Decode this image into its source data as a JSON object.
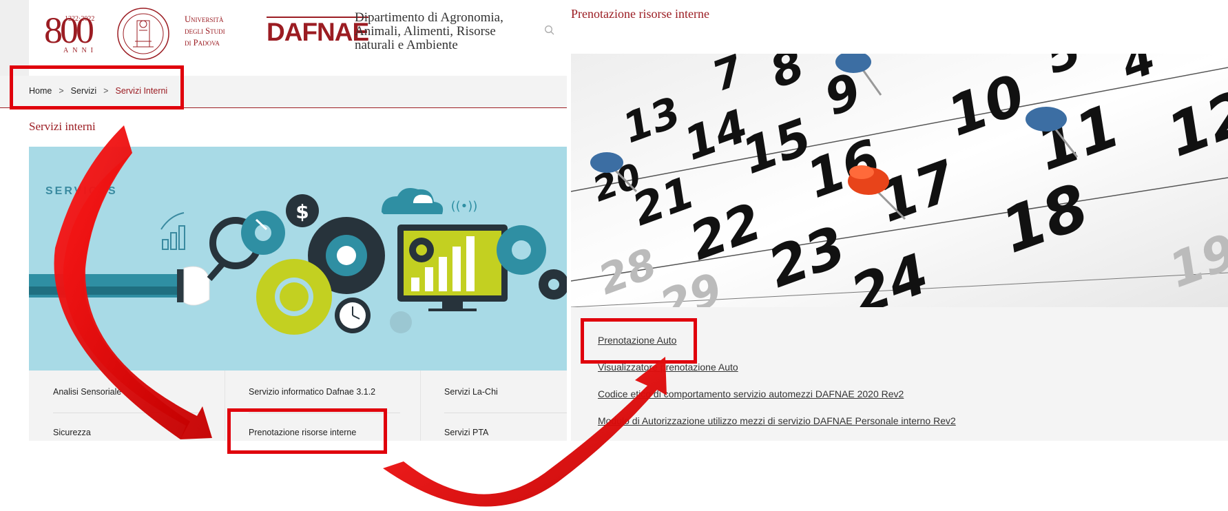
{
  "header": {
    "years": "1222·2022",
    "anni": "ANNI",
    "anniversary_big": "800",
    "university": [
      "Università",
      "degli Studi",
      "di Padova"
    ],
    "dept_logo": "DAFNAE",
    "dept_name": [
      "Dipartimento di Agronomia,",
      "Animali, Alimenti, Risorse",
      "naturali e Ambiente"
    ]
  },
  "breadcrumb": {
    "home": "Home",
    "servizi": "Servizi",
    "current": "Servizi Interni",
    "separator": ">"
  },
  "section_title": "Servizi interni",
  "banner": {
    "label": "SERVICES"
  },
  "tiles": [
    [
      "Analisi Sensoriale",
      "Servizio informatico Dafnae 3.1.2",
      "Servizi La-Chi"
    ],
    [
      "Sicurezza",
      "Prenotazione risorse interne",
      "Servizi PTA"
    ]
  ],
  "right_panel": {
    "title": "Prenotazione risorse interne",
    "links": [
      "Prenotazione Auto",
      "Visualizzatore prenotazione Auto",
      "Codice etico di comportamento servizio automezzi DAFNAE 2020 Rev2",
      "Modulo di Autorizzazione utilizzo mezzi di servizio DAFNAE Personale interno Rev2"
    ]
  },
  "calendar_numbers": [
    "7",
    "8",
    "9",
    "5",
    "4",
    "13",
    "14",
    "15",
    "16",
    "17",
    "10",
    "11",
    "12",
    "20",
    "21",
    "22",
    "23",
    "24",
    "18",
    "28",
    "29",
    "19"
  ],
  "colors": {
    "brand": "#9b1c22",
    "highlight": "#e0000c",
    "banner_bg": "#a8dae6",
    "teal": "#2f8fa3",
    "lime": "#c3d021",
    "dark": "#27333b"
  }
}
